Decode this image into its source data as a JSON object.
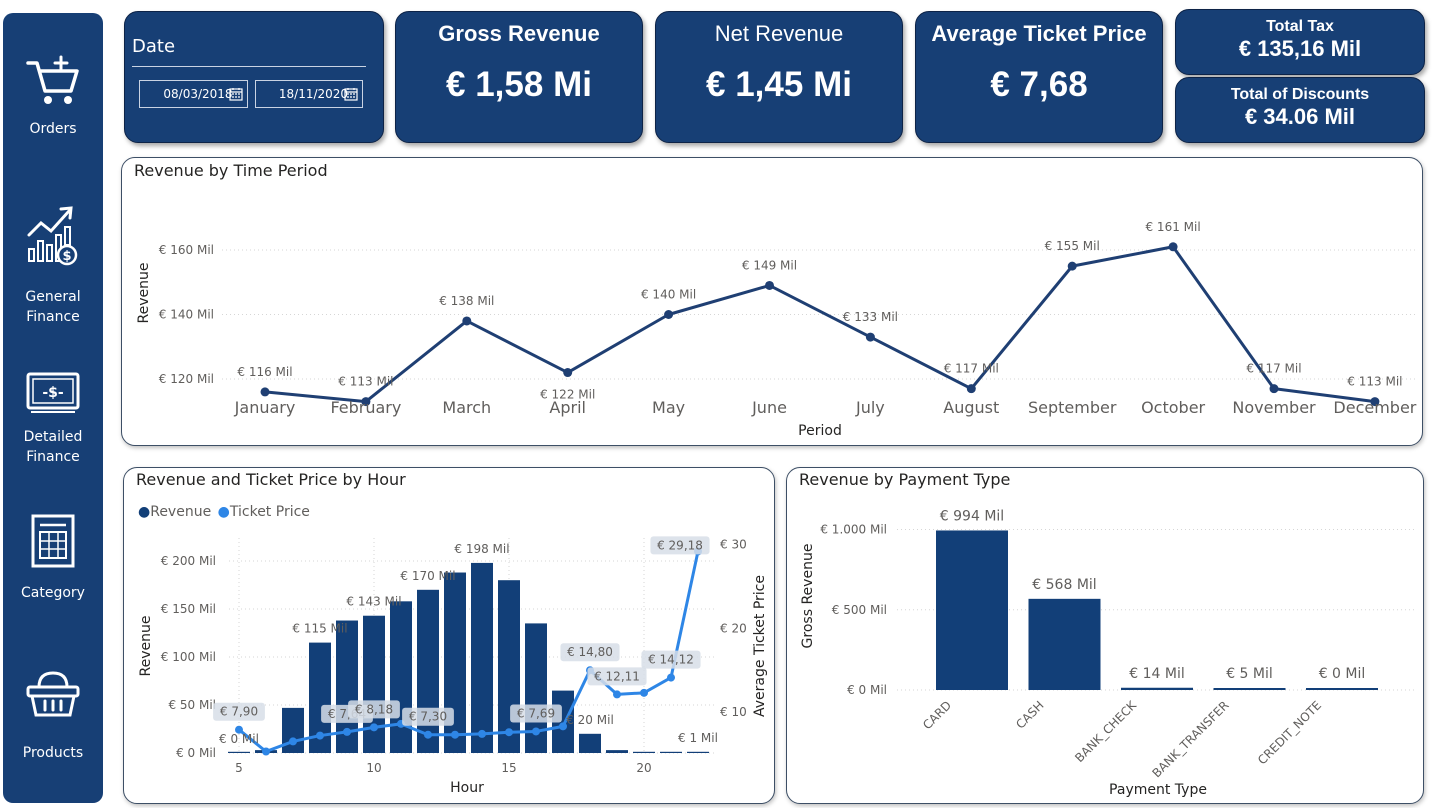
{
  "sidebar": {
    "items": [
      {
        "label": "Orders",
        "icon": "cart-plus-icon"
      },
      {
        "label": "General Finance",
        "icon": "growth-chart-icon"
      },
      {
        "label": "Detailed Finance",
        "icon": "banknote-icon"
      },
      {
        "label": "Category",
        "icon": "category-sheet-icon"
      },
      {
        "label": "Products",
        "icon": "basket-icon"
      }
    ]
  },
  "date_filter": {
    "title": "Date",
    "start": "08/03/2018",
    "end": "18/11/2020"
  },
  "kpis": {
    "gross_revenue": {
      "title": "Gross Revenue",
      "value": "€ 1,58 Mi"
    },
    "net_revenue": {
      "title": "Net Revenue",
      "value": "€ 1,45 Mi"
    },
    "avg_ticket": {
      "title": "Average Ticket Price",
      "value": "€ 7,68"
    },
    "total_tax": {
      "title": "Total Tax",
      "value": "€ 135,16 Mil"
    },
    "total_discounts": {
      "title": "Total of Discounts",
      "value": "€ 34.06 Mil"
    }
  },
  "colors": {
    "navy": "#173f75",
    "bar": "#123f78",
    "line_blue": "#2e86e6",
    "line_navy": "#1f3f73"
  },
  "chart_data": [
    {
      "type": "line",
      "title": "Revenue by Time Period",
      "xlabel": "Period",
      "ylabel": "Revenue",
      "categories": [
        "January",
        "February",
        "March",
        "April",
        "May",
        "June",
        "July",
        "August",
        "September",
        "October",
        "November",
        "December"
      ],
      "values": [
        116,
        113,
        138,
        122,
        140,
        149,
        133,
        117,
        155,
        161,
        117,
        113
      ],
      "data_labels": [
        "€ 116 Mil",
        "€ 113 Mil",
        "€ 138 Mil",
        "€ 122 Mil",
        "€ 140 Mil",
        "€ 149 Mil",
        "€ 133 Mil",
        "€ 117 Mil",
        "€ 155 Mil",
        "€ 161 Mil",
        "€ 117 Mil",
        "€ 113 Mil"
      ],
      "yticks": [
        {
          "v": 120,
          "label": "€ 120 Mil"
        },
        {
          "v": 140,
          "label": "€ 140 Mil"
        },
        {
          "v": 160,
          "label": "€ 160 Mil"
        }
      ],
      "ylim": [
        105,
        170
      ]
    },
    {
      "type": "bar",
      "title": "Revenue and Ticket Price by Hour",
      "xlabel": "Hour",
      "ylabel": "Revenue",
      "y2label": "Average Ticket Price",
      "legend": [
        "Revenue",
        "Ticket Price"
      ],
      "hours": [
        5,
        6,
        7,
        8,
        9,
        10,
        11,
        12,
        13,
        14,
        15,
        16,
        17,
        18,
        19,
        20,
        21,
        22
      ],
      "revenue": [
        0,
        3,
        47,
        115,
        138,
        143,
        158,
        170,
        188,
        198,
        180,
        135,
        65,
        20,
        3,
        1,
        1,
        1
      ],
      "ticket_price": [
        7.9,
        5.3,
        6.5,
        7.2,
        7.64,
        8.18,
        8.6,
        7.3,
        7.3,
        7.4,
        7.6,
        7.69,
        8.3,
        15.0,
        12.11,
        12.3,
        14.12,
        29.18
      ],
      "revenue_labels": [
        {
          "hour": 5,
          "text": "€ 0 Mil"
        },
        {
          "hour": 8,
          "text": "€ 115 Mil"
        },
        {
          "hour": 10,
          "text": "€ 143 Mil"
        },
        {
          "hour": 12,
          "text": "€ 170 Mil"
        },
        {
          "hour": 14,
          "text": "€ 198 Mil"
        },
        {
          "hour": 18,
          "text": "€ 20 Mil"
        },
        {
          "hour": 22,
          "text": "€ 1 Mil"
        }
      ],
      "price_labels": [
        {
          "hour": 5,
          "text": "€ 7,90"
        },
        {
          "hour": 9,
          "text": "€ 7,64"
        },
        {
          "hour": 10,
          "text": "€ 8,18"
        },
        {
          "hour": 12,
          "text": "€ 7,30"
        },
        {
          "hour": 16,
          "text": "€ 7,69"
        },
        {
          "hour": 18,
          "text": "€ 14,80"
        },
        {
          "hour": 19,
          "text": "€ 12,11"
        },
        {
          "hour": 21,
          "text": "€ 14,12"
        },
        {
          "hour": 22,
          "text": "€ 29,18"
        }
      ],
      "yticks": [
        {
          "v": 0,
          "label": "€ 0 Mil"
        },
        {
          "v": 50,
          "label": "€ 50 Mil"
        },
        {
          "v": 100,
          "label": "€ 100 Mil"
        },
        {
          "v": 150,
          "label": "€ 150 Mil"
        },
        {
          "v": 200,
          "label": "€ 200 Mil"
        }
      ],
      "y2ticks": [
        {
          "v": 10,
          "label": "€ 10"
        },
        {
          "v": 20,
          "label": "€ 20"
        },
        {
          "v": 30,
          "label": "€ 30"
        }
      ],
      "xticks": [
        5,
        10,
        15,
        20
      ],
      "ylim": [
        0,
        210
      ],
      "y2lim": [
        4.5,
        31
      ]
    },
    {
      "type": "bar",
      "title": "Revenue by Payment Type",
      "xlabel": "Payment Type",
      "ylabel": "Gross Revenue",
      "categories": [
        "CARD",
        "CASH",
        "BANK_CHECK",
        "BANK_TRANSFER",
        "CREDIT_NOTE"
      ],
      "values": [
        994,
        568,
        14,
        5,
        0
      ],
      "data_labels": [
        "€ 994 Mil",
        "€ 568 Mil",
        "€ 14 Mil",
        "€ 5 Mil",
        "€ 0 Mil"
      ],
      "yticks": [
        {
          "v": 0,
          "label": "€ 0 Mil"
        },
        {
          "v": 500,
          "label": "€ 500 Mil"
        },
        {
          "v": 1000,
          "label": "€ 1.000 Mil"
        }
      ],
      "ylim": [
        0,
        1050
      ]
    }
  ]
}
